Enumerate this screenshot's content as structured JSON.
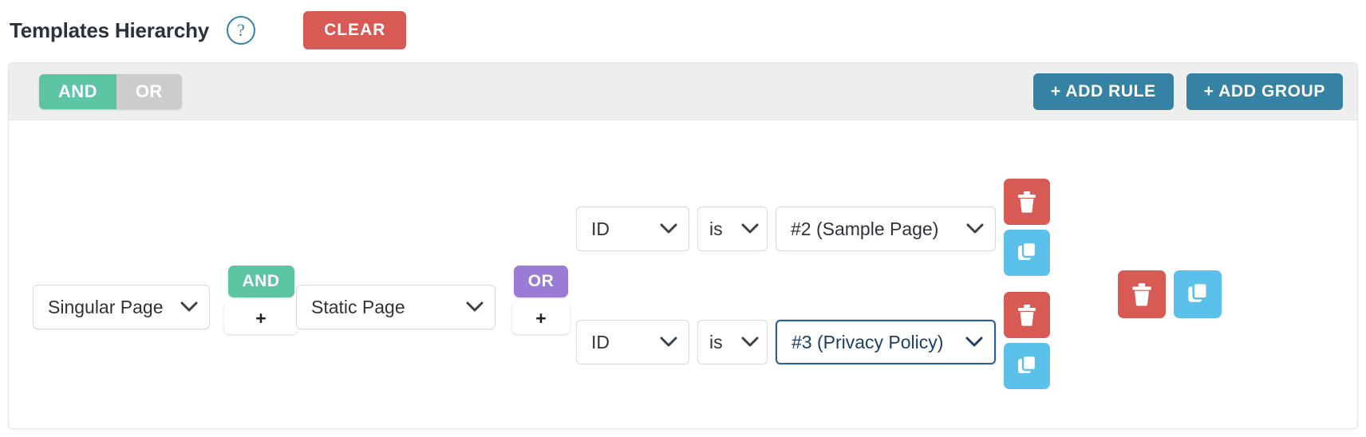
{
  "header": {
    "title": "Templates Hierarchy",
    "help_icon": "question-mark-circle-icon",
    "clear_label": "CLEAR",
    "clear_color": "#d75a54"
  },
  "builder": {
    "group_header": {
      "conjunction": {
        "and_label": "AND",
        "or_label": "OR",
        "selected": "AND"
      },
      "add_rule_label": "+ ADD RULE",
      "add_group_label": "+ ADD GROUP",
      "accent_color": "#3582a5",
      "and_color": "#5dc4a4",
      "or_color": "#cccccc"
    },
    "left_conditions": [
      {
        "value": "Singular Page"
      },
      {
        "value": "Static Page"
      }
    ],
    "and_connector": {
      "label": "AND",
      "add_label": "+",
      "color": "#5dc4a4"
    },
    "or_connector": {
      "label": "OR",
      "add_label": "+",
      "color": "#9a7cd6"
    },
    "rules": [
      {
        "field": "ID",
        "operator": "is",
        "value": "#2 (Sample Page)",
        "focused": false,
        "delete_icon": "trash-icon",
        "copy_icon": "copy-icon"
      },
      {
        "field": "ID",
        "operator": "is",
        "value": "#3 (Privacy Policy)",
        "focused": true,
        "delete_icon": "trash-icon",
        "copy_icon": "copy-icon"
      }
    ],
    "group_actions": {
      "delete_icon": "trash-icon",
      "copy_icon": "copy-icon",
      "delete_color": "#d75a54",
      "copy_color": "#5bc0ea"
    }
  }
}
